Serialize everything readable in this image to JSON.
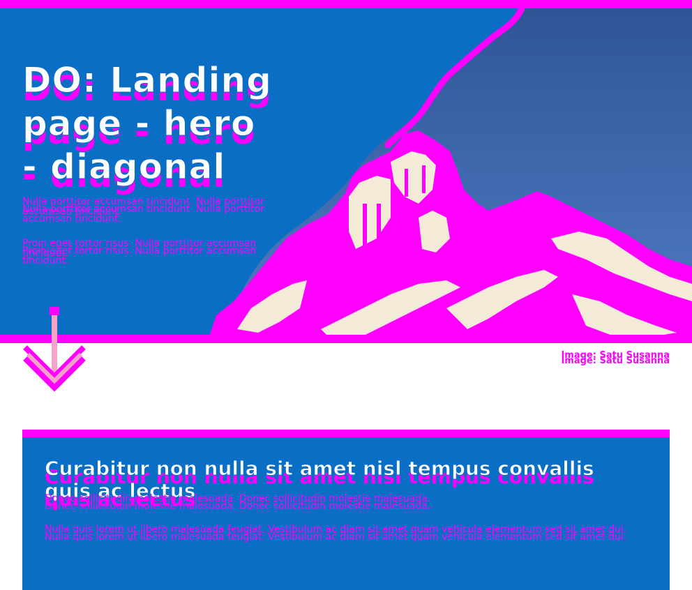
{
  "hero": {
    "title": "DO: Landing page - hero - diagonal",
    "paragraph_1": "Nulla porttitor accumsan tincidunt. Nulla porttitor accumsan tincidunt.",
    "paragraph_2": "Proin eget tortor risus. Nulla porttitor accumsan tincidunt.",
    "image_alt_icon": "building-photo",
    "scroll_icon": "chevron-down-arrow-icon"
  },
  "image_credit": "Image: Satu Susanna",
  "card": {
    "title": "Curabitur non nulla sit amet nisl tempus convallis quis ac lectus",
    "paragraph_1": "Donec sollicitudin molestie malesuada. Donec sollicitudin molestie malesuada.",
    "paragraph_2": "Nulla quis lorem ut libero malesuada feugiat. Vestibulum ac diam sit amet quam vehicula elementum sed sit amet dui."
  },
  "colors": {
    "magenta": "#ff00ff",
    "blue": "#0a6ec5",
    "sky": "#3a66b0",
    "stone": "#f3ead8",
    "arrow_pink": "#f7a3c8"
  }
}
